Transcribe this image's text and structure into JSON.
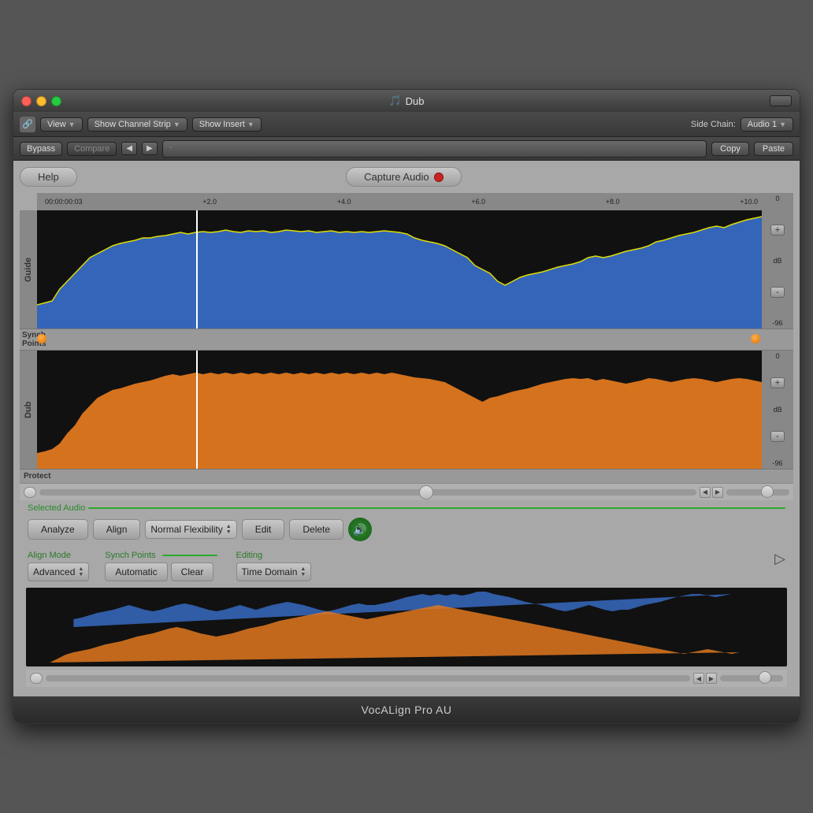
{
  "window": {
    "title": "Dub",
    "title_icon": "🎵"
  },
  "toolbar1": {
    "view_label": "View",
    "show_channel_strip_label": "Show Channel Strip",
    "show_insert_label": "Show Insert",
    "side_chain_label": "Side Chain:",
    "audio1_label": "Audio 1"
  },
  "toolbar2": {
    "bypass_label": "Bypass",
    "compare_label": "Compare",
    "preset_placeholder": "-",
    "copy_label": "Copy",
    "paste_label": "Paste"
  },
  "plugin": {
    "help_label": "Help",
    "capture_label": "Capture Audio",
    "time_marks": [
      "00:00:00:03",
      "+2.0",
      "+4.0",
      "+6.0",
      "+8.0",
      "+10.0"
    ],
    "guide_label": "Guide",
    "dub_label": "Dub",
    "synch_points_label": "Synch\nPoints",
    "protect_label": "Protect",
    "db_zero": "0",
    "db_mid": "dB",
    "db_neg96": "-96",
    "selected_audio_label": "Selected Audio",
    "analyze_label": "Analyze",
    "align_label": "Align",
    "flexibility_label": "Normal Flexibility",
    "edit_label": "Edit",
    "delete_label": "Delete",
    "align_mode_label": "Align Mode",
    "advanced_label": "Advanced",
    "synch_points_section_label": "Synch Points",
    "automatic_label": "Automatic",
    "clear_label": "Clear",
    "editing_label": "Editing",
    "time_domain_label": "Time Domain",
    "app_name": "VocALign Pro AU",
    "cursor_label": "▷"
  }
}
